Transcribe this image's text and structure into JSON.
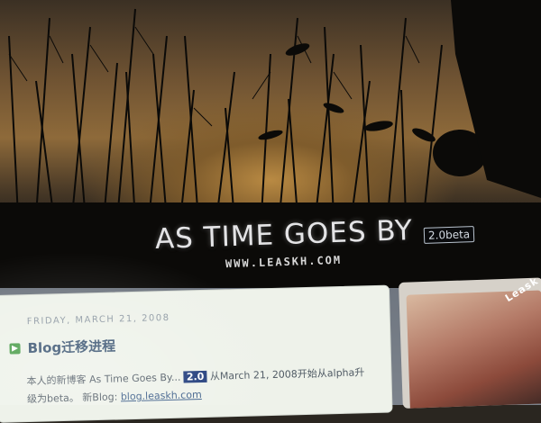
{
  "header": {
    "title": "AS TIME GOES BY",
    "version": "2.0beta",
    "url": "WWW.LEASKH.COM"
  },
  "post": {
    "date": "FRIDAY, MARCH 21, 2008",
    "title": "Blog迁移进程",
    "body_prefix": "本人的新博客 As Time Goes By...",
    "badge": "2.0",
    "body_suffix": "从March 21, 2008开始从alpha升",
    "body_line2": "级为beta。",
    "link_prefix": "新Blog:",
    "link_text": "blog.leaskh.com"
  },
  "sidebar": {
    "avatar_label": "Leask"
  },
  "colors": {
    "banner_glow": "#b98a43",
    "title_blue": "#3c5673",
    "badge_bg": "#1e3a7a"
  }
}
